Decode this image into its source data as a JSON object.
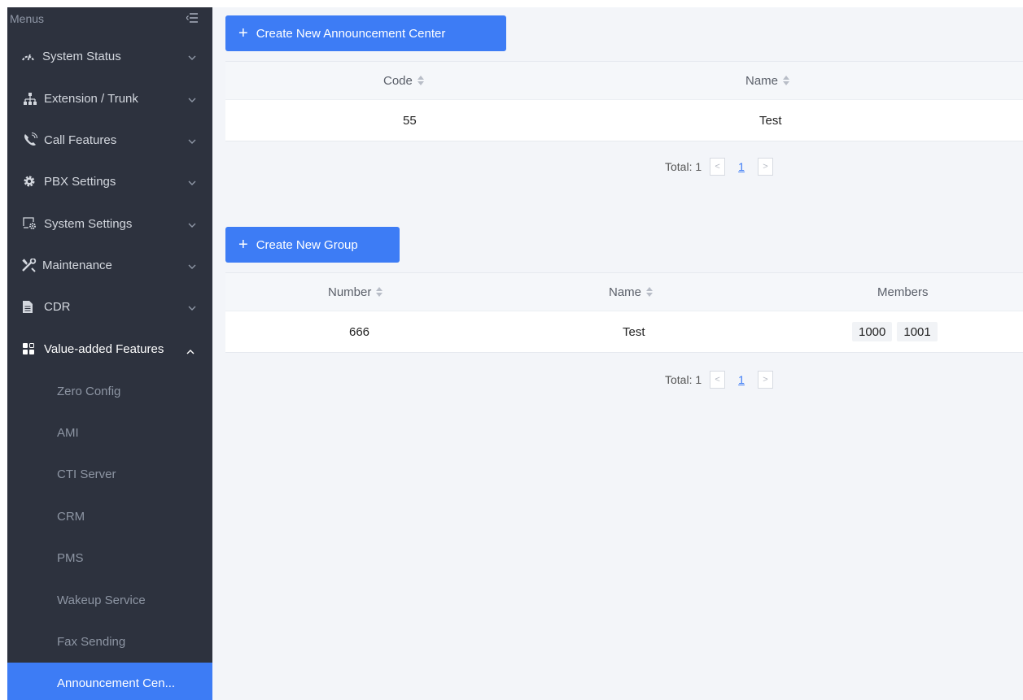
{
  "sidebar": {
    "title": "Menus",
    "menu": [
      {
        "label": "System Status",
        "icon": "gauge-icon"
      },
      {
        "label": "Extension / Trunk",
        "icon": "network-icon"
      },
      {
        "label": "Call Features",
        "icon": "phone-call-icon"
      },
      {
        "label": "PBX Settings",
        "icon": "gear-icon"
      },
      {
        "label": "System Settings",
        "icon": "system-settings-icon"
      },
      {
        "label": "Maintenance",
        "icon": "tools-icon"
      },
      {
        "label": "CDR",
        "icon": "document-icon"
      },
      {
        "label": "Value-added Features",
        "icon": "apps-icon"
      }
    ],
    "submenu": [
      {
        "label": "Zero Config"
      },
      {
        "label": "AMI"
      },
      {
        "label": "CTI Server"
      },
      {
        "label": "CRM"
      },
      {
        "label": "PMS"
      },
      {
        "label": "Wakeup Service"
      },
      {
        "label": "Fax Sending"
      },
      {
        "label": "Announcement Cen..."
      }
    ],
    "accent": "#3d7cf5"
  },
  "announcement": {
    "create_label": "Create New Announcement Center",
    "columns": [
      "Code",
      "Name"
    ],
    "rows": [
      {
        "code": "55",
        "name": "Test"
      }
    ],
    "pager": {
      "total_label": "Total: 1",
      "page": "1",
      "prev": "<",
      "next": ">"
    }
  },
  "group": {
    "create_label": "Create New Group",
    "columns": [
      "Number",
      "Name",
      "Members"
    ],
    "rows": [
      {
        "number": "666",
        "name": "Test",
        "members": [
          "1000",
          "1001"
        ]
      }
    ],
    "pager": {
      "total_label": "Total: 1",
      "page": "1",
      "prev": "<",
      "next": ">"
    }
  }
}
